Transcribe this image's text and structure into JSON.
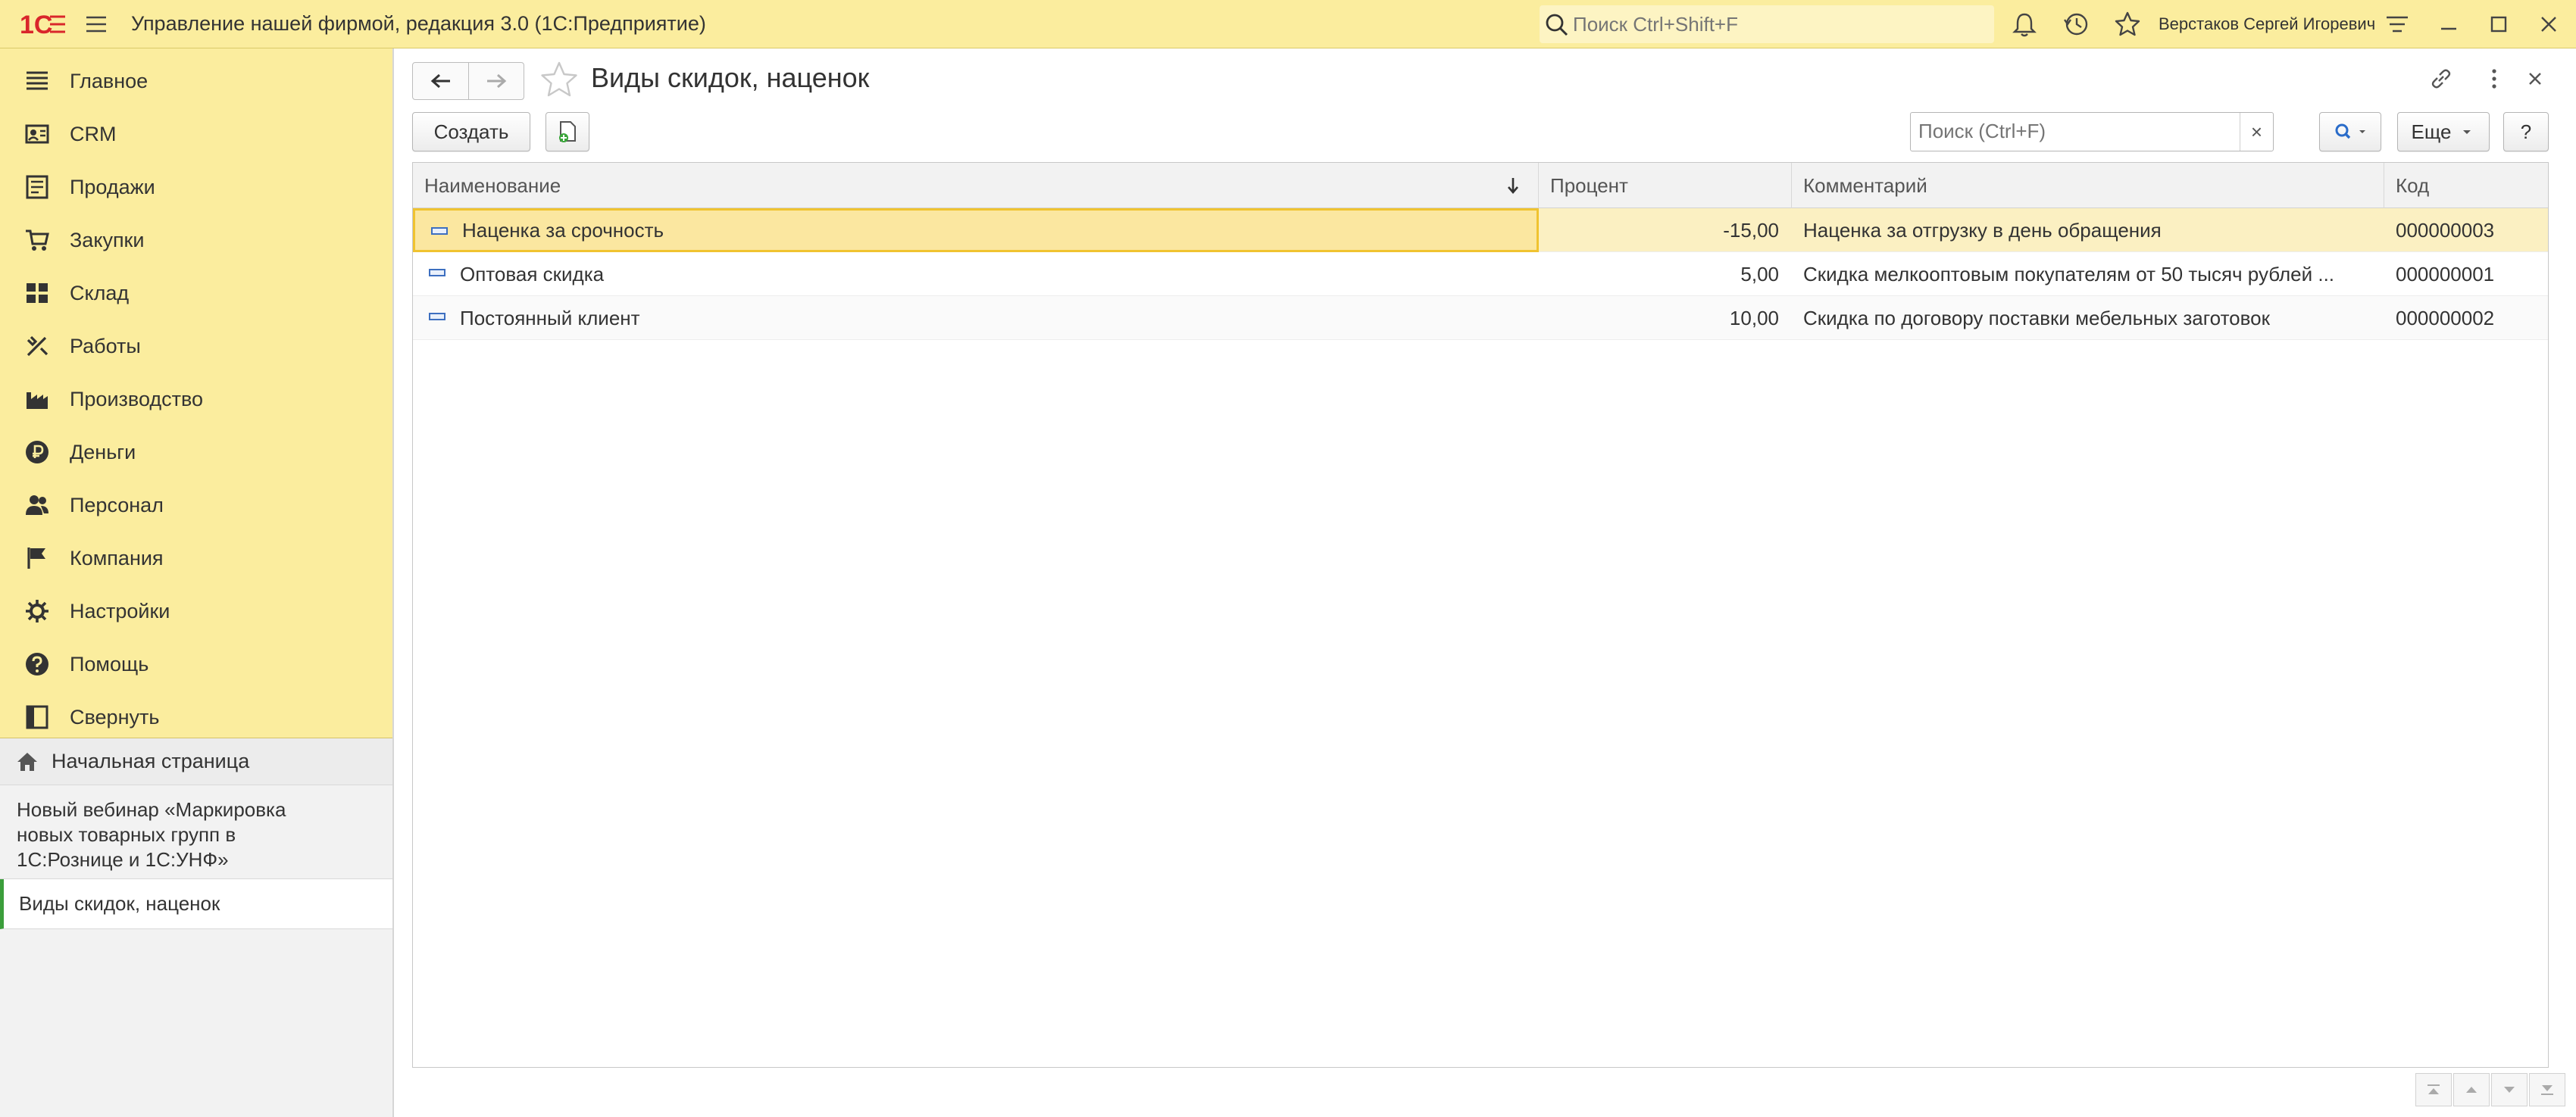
{
  "titlebar": {
    "logo_text": "1С",
    "app_title": "Управление нашей фирмой, редакция 3.0  (1С:Предприятие)",
    "search_placeholder": "Поиск Ctrl+Shift+F",
    "user_name": "Верстаков Сергей Игоревич",
    "accent_color": "#fbed9e"
  },
  "sidebar": {
    "sections": [
      {
        "label": "Главное",
        "icon": "list-icon"
      },
      {
        "label": "CRM",
        "icon": "crm-icon"
      },
      {
        "label": "Продажи",
        "icon": "sales-icon"
      },
      {
        "label": "Закупки",
        "icon": "cart-icon"
      },
      {
        "label": "Склад",
        "icon": "warehouse-icon"
      },
      {
        "label": "Работы",
        "icon": "tools-icon"
      },
      {
        "label": "Производство",
        "icon": "factory-icon"
      },
      {
        "label": "Деньги",
        "icon": "ruble-icon"
      },
      {
        "label": "Персонал",
        "icon": "people-icon"
      },
      {
        "label": "Компания",
        "icon": "flag-icon"
      },
      {
        "label": "Настройки",
        "icon": "gear-icon"
      },
      {
        "label": "Помощь",
        "icon": "help-icon"
      },
      {
        "label": "Свернуть",
        "icon": "collapse-icon"
      }
    ],
    "home": "Начальная страница",
    "news": [
      "Новый вебинар «Маркировка",
      "новых товарных групп в",
      "1С:Рознице и 1С:УНФ»"
    ],
    "open_form": "Виды скидок, наценок"
  },
  "form": {
    "title": "Виды скидок, наценок",
    "create_label": "Создать",
    "search_placeholder": "Поиск (Ctrl+F)",
    "clear_label": "×",
    "more_label": "Еще",
    "help_label": "?"
  },
  "table": {
    "columns": [
      "Наименование",
      "Процент",
      "Комментарий",
      "Код"
    ],
    "rows": [
      {
        "name": "Наценка за срочность",
        "percent": "-15,00",
        "comment": "Наценка за отгрузку в день обращения",
        "code": "000000003"
      },
      {
        "name": "Оптовая скидка",
        "percent": "5,00",
        "comment": "Скидка мелкооптовым покупателям от 50 тысяч рублей ...",
        "code": "000000001"
      },
      {
        "name": "Постоянный клиент",
        "percent": "10,00",
        "comment": "Скидка по договору поставки мебельных заготовок",
        "code": "000000002"
      }
    ]
  }
}
